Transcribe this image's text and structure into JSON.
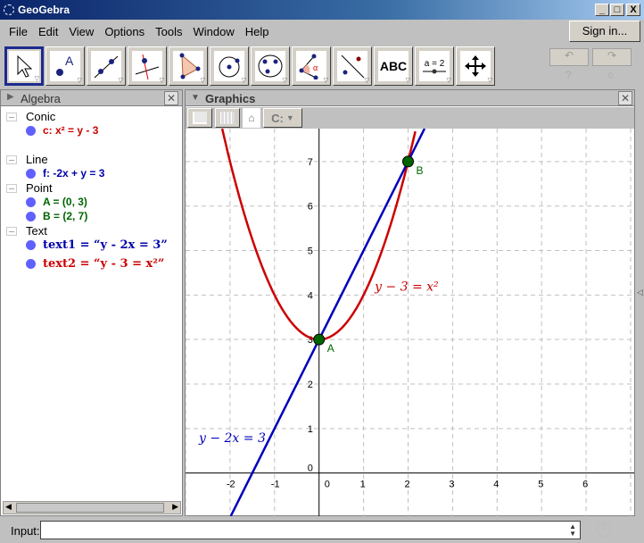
{
  "window": {
    "title": "GeoGebra",
    "minimize": "_",
    "maximize": "□",
    "close": "X"
  },
  "menu": [
    "File",
    "Edit",
    "View",
    "Options",
    "Tools",
    "Window",
    "Help"
  ],
  "signin": "Sign in...",
  "tools": [
    {
      "name": "move"
    },
    {
      "name": "point"
    },
    {
      "name": "line"
    },
    {
      "name": "perpendicular-line"
    },
    {
      "name": "polygon"
    },
    {
      "name": "circle-center"
    },
    {
      "name": "circle-three-points"
    },
    {
      "name": "angle"
    },
    {
      "name": "reflect"
    },
    {
      "name": "text",
      "label": "ABC"
    },
    {
      "name": "slider",
      "label": "a = 2"
    },
    {
      "name": "move-graphics"
    }
  ],
  "algebra": {
    "title": "Algebra",
    "groups": [
      {
        "label": "Conic",
        "items": [
          {
            "text": "c: x² = y - 3",
            "color": "#cc0000"
          }
        ]
      },
      {
        "label": "Line",
        "items": [
          {
            "text": "f: -2x + y = 3",
            "color": "#0000aa"
          }
        ]
      },
      {
        "label": "Point",
        "items": [
          {
            "text": "A = (0, 3)",
            "color": "#006400"
          },
          {
            "text": "B = (2, 7)",
            "color": "#006400"
          }
        ]
      },
      {
        "label": "Text",
        "items": [
          {
            "text": "text1 = “y - 2x = 3”",
            "color": "#0000aa"
          },
          {
            "text": "text2 = “y - 3 = x²”",
            "color": "#cc0000"
          }
        ]
      }
    ]
  },
  "graphics": {
    "title": "Graphics",
    "graph_style_btn": "C:",
    "xticks": [
      -2,
      -1,
      0,
      1,
      2,
      3,
      4,
      5,
      6
    ],
    "yticks": [
      0,
      1,
      2,
      3,
      4,
      5,
      6,
      7
    ],
    "xrange": [
      -3,
      7.08
    ],
    "yrange": [
      -0.97,
      7.74
    ],
    "parabola": {
      "equation": "x² = y - 3",
      "color": "#cc0000",
      "label": "y − 3 = x²"
    },
    "line": {
      "equation": "-2x + y = 3",
      "color": "#0000bb",
      "label": "y − 2x = 3"
    },
    "points": [
      {
        "name": "A",
        "x": 0,
        "y": 3
      },
      {
        "name": "B",
        "x": 2,
        "y": 7
      }
    ],
    "point_color": "#006400"
  },
  "input": {
    "label": "Input:",
    "value": ""
  }
}
